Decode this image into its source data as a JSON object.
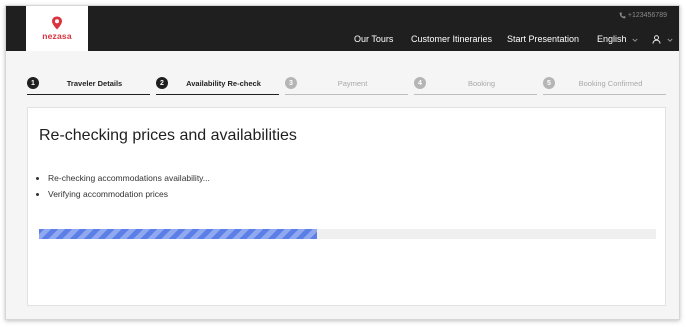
{
  "header": {
    "logo_text": "nezasa",
    "phone": "+123456789",
    "nav": {
      "our_tours": "Our Tours",
      "customer_itineraries": "Customer Itineraries",
      "start_presentation": "Start Presentation",
      "language": "English"
    }
  },
  "stepper": [
    {
      "number": "1",
      "label": "Traveler Details",
      "state": "done"
    },
    {
      "number": "2",
      "label": "Availability Re-check",
      "state": "done"
    },
    {
      "number": "3",
      "label": "Payment",
      "state": "todo"
    },
    {
      "number": "4",
      "label": "Booking",
      "state": "todo"
    },
    {
      "number": "5",
      "label": "Booking Confirmed",
      "state": "todo"
    }
  ],
  "main": {
    "title": "Re-checking prices and availabilities",
    "items": [
      "Re-checking accommodations availability...",
      "Verifying accommodation prices"
    ],
    "progress": 0.45
  },
  "colors": {
    "header_bg": "#1f1f1f",
    "brand": "#d9333f",
    "progress": "#5b7fe6"
  },
  "icons": {
    "logo": "location-pin-icon",
    "phone": "phone-icon",
    "language": "chevron-down-icon",
    "user": "user-icon"
  }
}
